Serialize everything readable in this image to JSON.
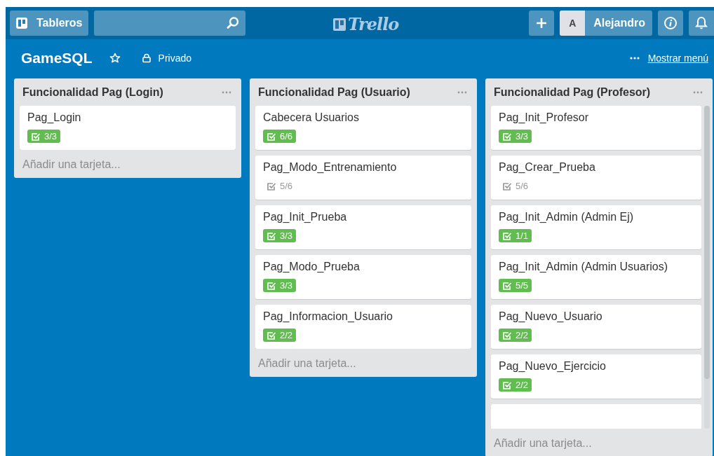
{
  "header": {
    "boards_button": "Tableros",
    "logo": "Trello",
    "user_initial": "A",
    "user_name": "Alejandro"
  },
  "board": {
    "title": "GameSQL",
    "starred": false,
    "visibility": "Privado",
    "menu_link": "Mostrar menú"
  },
  "lists": [
    {
      "title": "Funcionalidad Pag (Login)",
      "add_card": "Añadir una tarjeta...",
      "scrollable": false,
      "cards": [
        {
          "title": "Pag_Login",
          "checklist": "3/3",
          "complete": true
        }
      ]
    },
    {
      "title": "Funcionalidad Pag (Usuario)",
      "add_card": "Añadir una tarjeta...",
      "scrollable": false,
      "cards": [
        {
          "title": "Cabecera Usuarios",
          "checklist": "6/6",
          "complete": true
        },
        {
          "title": "Pag_Modo_Entrenamiento",
          "checklist": "5/6",
          "complete": false
        },
        {
          "title": "Pag_Init_Prueba",
          "checklist": "3/3",
          "complete": true
        },
        {
          "title": "Pag_Modo_Prueba",
          "checklist": "3/3",
          "complete": true
        },
        {
          "title": "Pag_Informacion_Usuario",
          "checklist": "2/2",
          "complete": true
        }
      ]
    },
    {
      "title": "Funcionalidad Pag (Profesor)",
      "add_card": "Añadir una tarjeta...",
      "scrollable": true,
      "cards": [
        {
          "title": "Pag_Init_Profesor",
          "checklist": "3/3",
          "complete": true
        },
        {
          "title": "Pag_Crear_Prueba",
          "checklist": "5/6",
          "complete": false
        },
        {
          "title": "Pag_Init_Admin (Admin Ej)",
          "checklist": "1/1",
          "complete": true
        },
        {
          "title": "Pag_Init_Admin (Admin Usuarios)",
          "checklist": "5/5",
          "complete": true
        },
        {
          "title": "Pag_Nuevo_Usuario",
          "checklist": "2/2",
          "complete": true
        },
        {
          "title": "Pag_Nuevo_Ejercicio",
          "checklist": "2/2",
          "complete": true
        }
      ]
    }
  ]
}
